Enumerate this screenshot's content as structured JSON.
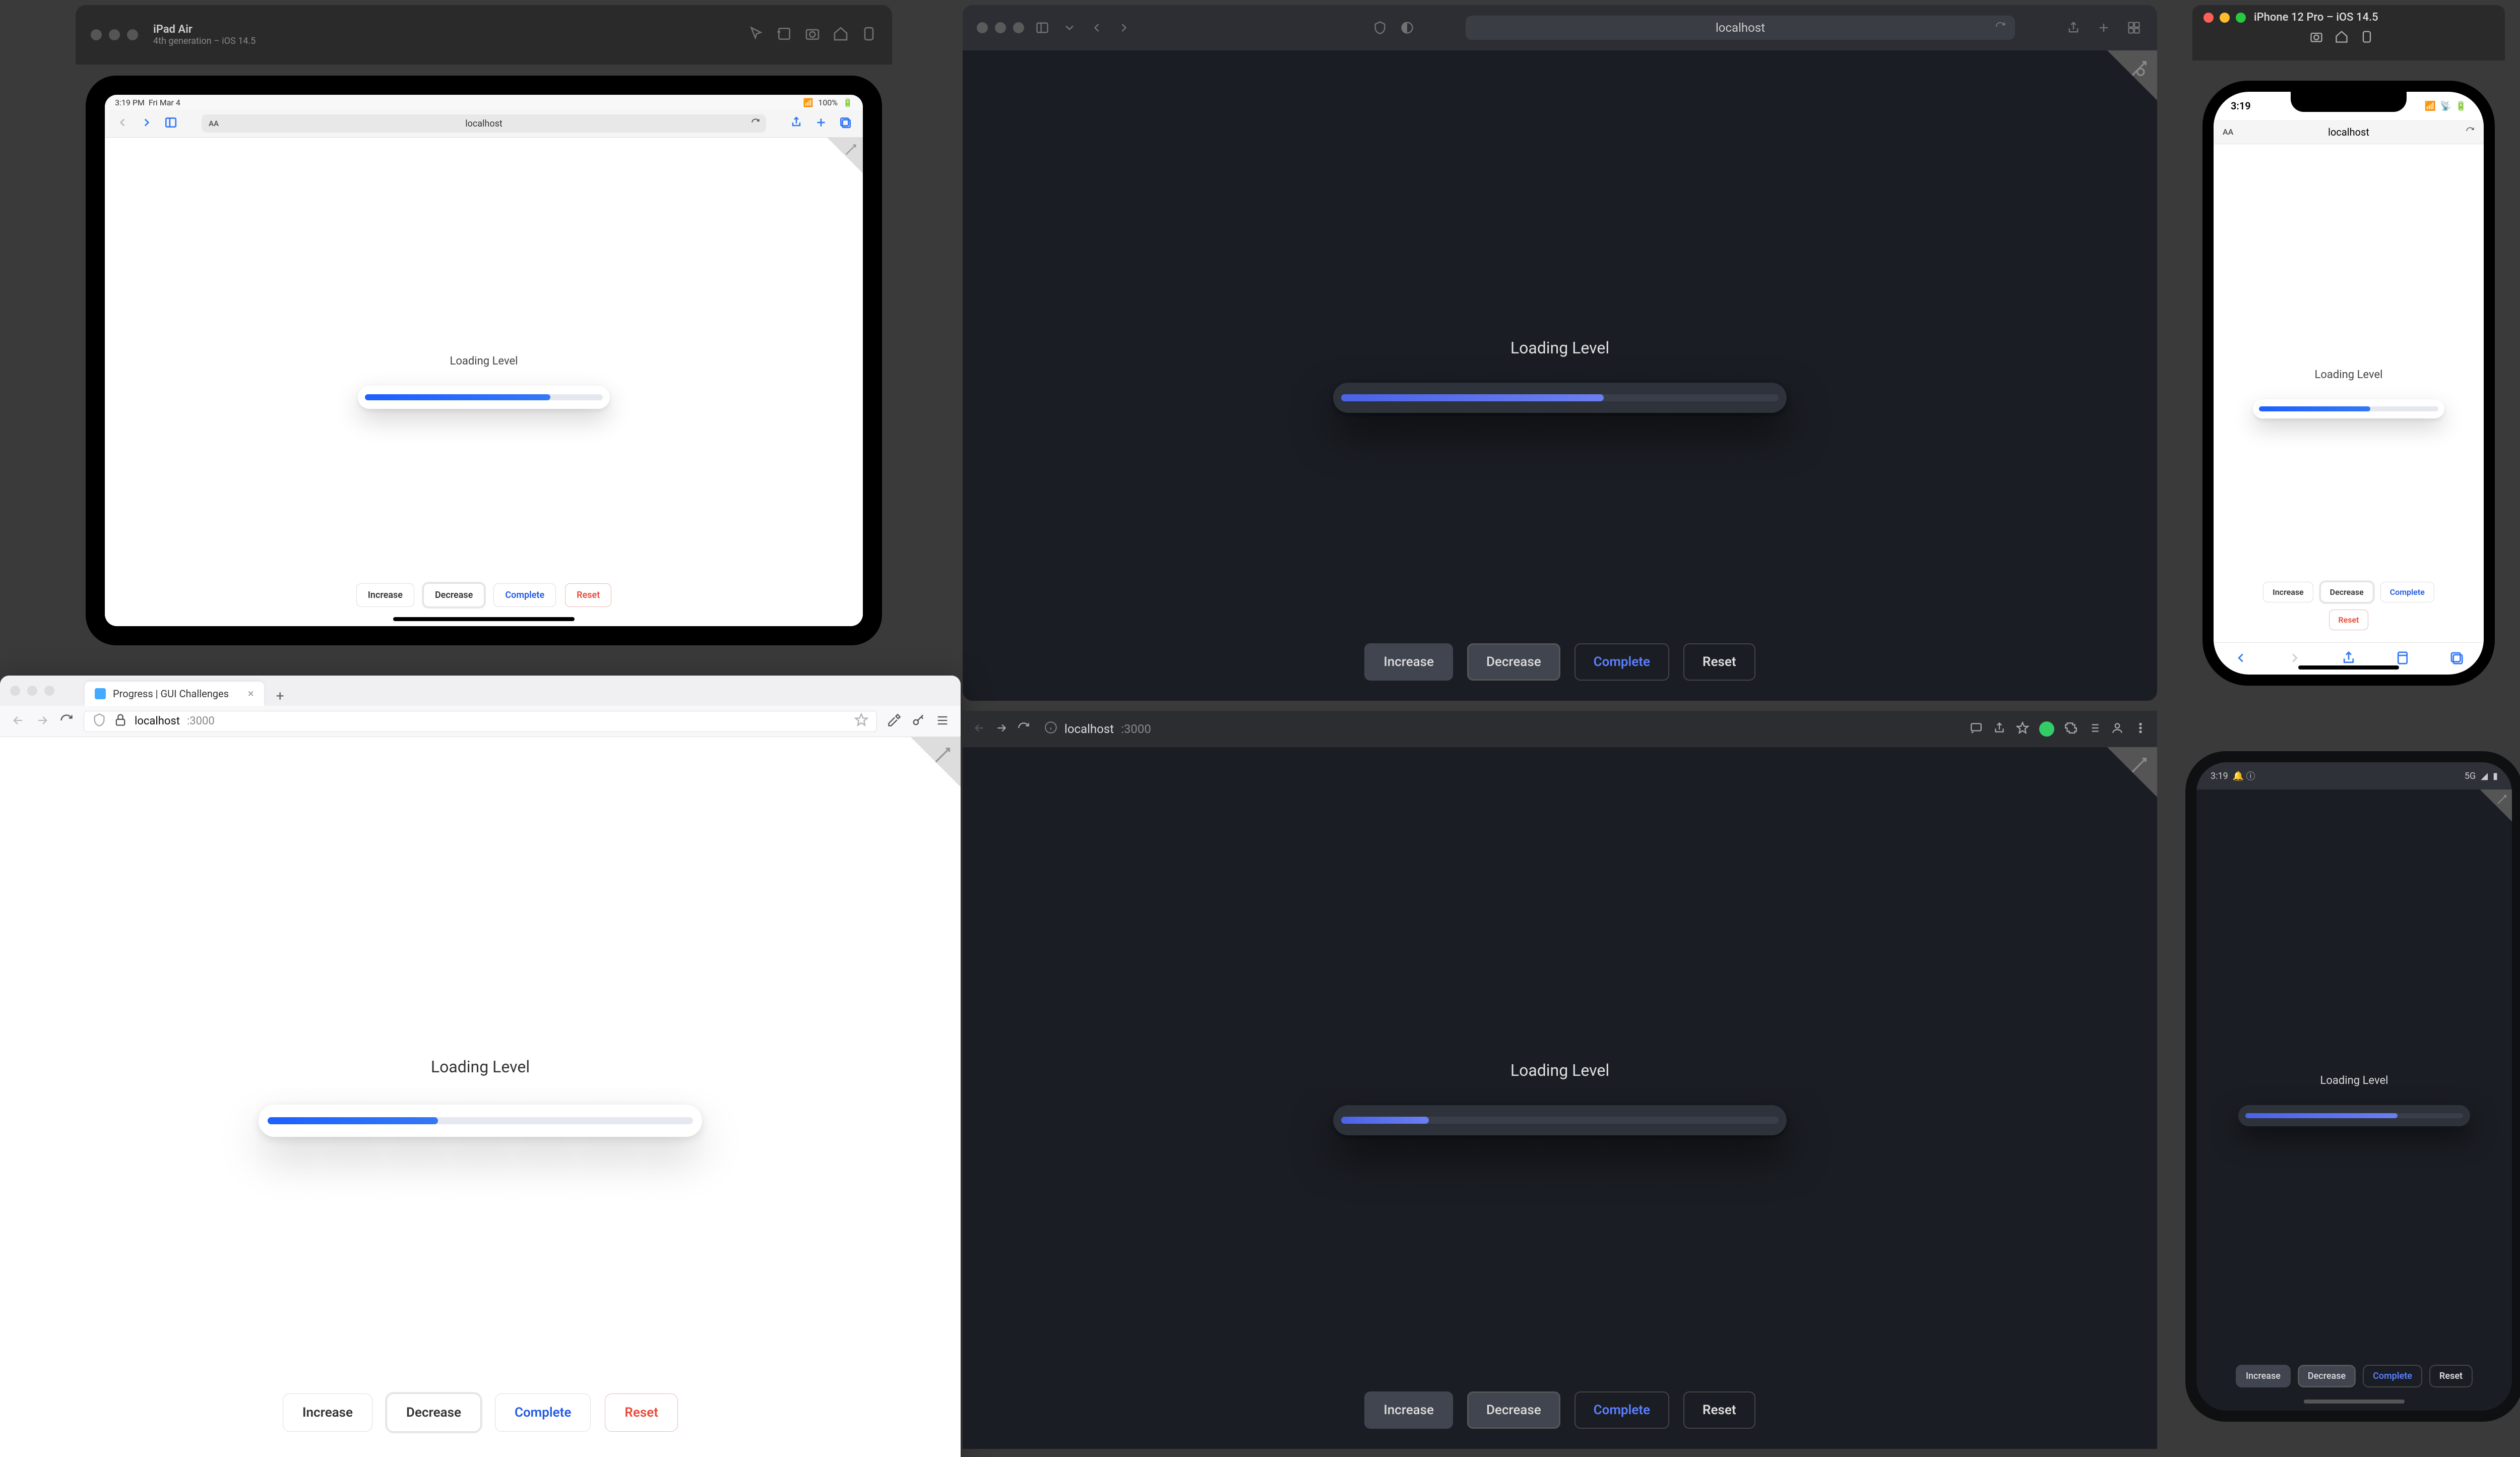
{
  "app": {
    "loading_label": "Loading Level",
    "buttons": {
      "increase": "Increase",
      "decrease": "Decrease",
      "complete": "Complete",
      "reset": "Reset"
    }
  },
  "safari_dark": {
    "url_text": "localhost",
    "progress_pct": 60
  },
  "ipad": {
    "sim_title": "iPad Air",
    "sim_subtitle": "4th generation – iOS 14.5",
    "status_time": "3:19 PM",
    "status_date": "Fri Mar 4",
    "status_battery": "100%",
    "url_text": "localhost",
    "aa": "AA",
    "progress_pct": 78
  },
  "firefox": {
    "tab_title": "Progress | GUI Challenges",
    "url_host": "localhost",
    "url_port": ":3000",
    "progress_pct": 40
  },
  "chrome_dark": {
    "url_host": "localhost",
    "url_port": ":3000",
    "progress_pct": 20
  },
  "iphone": {
    "sim_title": "iPhone 12 Pro – iOS 14.5",
    "status_time": "3:19",
    "url_text": "localhost",
    "aa": "AA",
    "progress_pct": 62
  },
  "android": {
    "status_time": "3:19",
    "status_icons": "5G",
    "progress_pct": 70
  }
}
